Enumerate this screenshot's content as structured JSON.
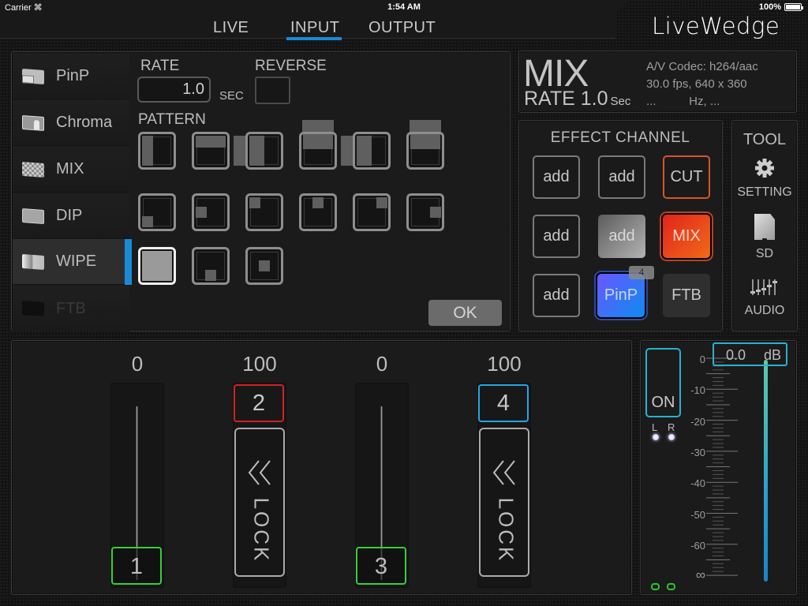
{
  "status_bar": {
    "carrier": "Carrier",
    "time": "1:54 AM",
    "battery": "100%"
  },
  "brand": "LiveWedge",
  "nav": {
    "tabs": [
      {
        "label": "LIVE",
        "active": false
      },
      {
        "label": "INPUT",
        "active": true
      },
      {
        "label": "OUTPUT",
        "active": false
      }
    ],
    "accent_color": "#1b8ad6"
  },
  "effect_types": {
    "items": [
      {
        "label": "PinP",
        "icon": "pinp-icon",
        "state": "normal"
      },
      {
        "label": "Chroma",
        "icon": "chroma-icon",
        "state": "normal"
      },
      {
        "label": "MIX",
        "icon": "mix-icon",
        "state": "normal"
      },
      {
        "label": "DIP",
        "icon": "dip-icon",
        "state": "normal"
      },
      {
        "label": "WIPE",
        "icon": "wipe-icon",
        "state": "active"
      },
      {
        "label": "FTB",
        "icon": "ftb-icon",
        "state": "disabled"
      }
    ]
  },
  "settings": {
    "rate_label": "RATE",
    "rate_value": "1.0",
    "rate_unit": "SEC",
    "reverse_label": "REVERSE",
    "reverse_checked": false,
    "pattern_label": "PATTERN",
    "patterns": [
      {
        "name": "wipe-left-to-right",
        "selected": false
      },
      {
        "name": "wipe-top-to-bottom",
        "selected": false
      },
      {
        "name": "slide-left-to-right",
        "selected": false
      },
      {
        "name": "slide-top-to-bottom",
        "selected": false
      },
      {
        "name": "push-left-to-right",
        "selected": false
      },
      {
        "name": "push-top-to-bottom",
        "selected": false
      },
      {
        "name": "box-bottom-left",
        "selected": false
      },
      {
        "name": "box-left",
        "selected": false
      },
      {
        "name": "box-top-left",
        "selected": false
      },
      {
        "name": "box-top",
        "selected": false
      },
      {
        "name": "box-top-right",
        "selected": false
      },
      {
        "name": "box-right",
        "selected": false
      },
      {
        "name": "full",
        "selected": true
      },
      {
        "name": "box-bottom",
        "selected": false
      },
      {
        "name": "box-center",
        "selected": false
      }
    ],
    "ok_label": "OK"
  },
  "info": {
    "effect": "MIX",
    "rate_prefix": "RATE",
    "rate_value": "1.0",
    "rate_unit": "Sec",
    "codec_line": "A/V Codec:  h264/aac",
    "video_line": "30.0 fps, 640 x 360",
    "audio_line": "...          Hz, ..."
  },
  "effect_channel": {
    "title": "EFFECT CHANNEL",
    "buttons": [
      {
        "label": "add",
        "style": "empty"
      },
      {
        "label": "add",
        "style": "empty"
      },
      {
        "label": "CUT",
        "style": "cut"
      },
      {
        "label": "add",
        "style": "empty"
      },
      {
        "label": "add",
        "style": "selected"
      },
      {
        "label": "MIX",
        "style": "mix-active"
      },
      {
        "label": "add",
        "style": "empty"
      },
      {
        "label": "PinP",
        "style": "pinp-active",
        "badge": "4"
      },
      {
        "label": "FTB",
        "style": "ftb"
      }
    ],
    "colors": {
      "cut": "#d6532b",
      "mix": "#e1241d",
      "pinp": "#2e7bf6"
    }
  },
  "tool": {
    "title": "TOOL",
    "items": [
      {
        "label": "SETTING",
        "icon": "gear-icon"
      },
      {
        "label": "SD",
        "icon": "sd-card-icon"
      },
      {
        "label": "AUDIO",
        "icon": "audio-mixer-icon"
      }
    ]
  },
  "faders": [
    {
      "value": "0",
      "channel": "1",
      "type": "slider",
      "level_percent": 0,
      "color": "#35d03a"
    },
    {
      "value": "100",
      "channel": "2",
      "type": "lock",
      "lock_label": "LOCK",
      "color": "#d42121"
    },
    {
      "value": "0",
      "channel": "3",
      "type": "slider",
      "level_percent": 0,
      "color": "#35d03a"
    },
    {
      "value": "100",
      "channel": "4",
      "type": "lock",
      "lock_label": "LOCK",
      "color": "#21a7e3"
    }
  ],
  "audio": {
    "on_label": "ON",
    "left_label": "L",
    "right_label": "R",
    "db_value": "0.0",
    "db_unit": "dB",
    "scale": [
      "0",
      "-10",
      "-20",
      "-30",
      "-40",
      "-50",
      "-60",
      "∞"
    ],
    "level_db": 0.0
  }
}
